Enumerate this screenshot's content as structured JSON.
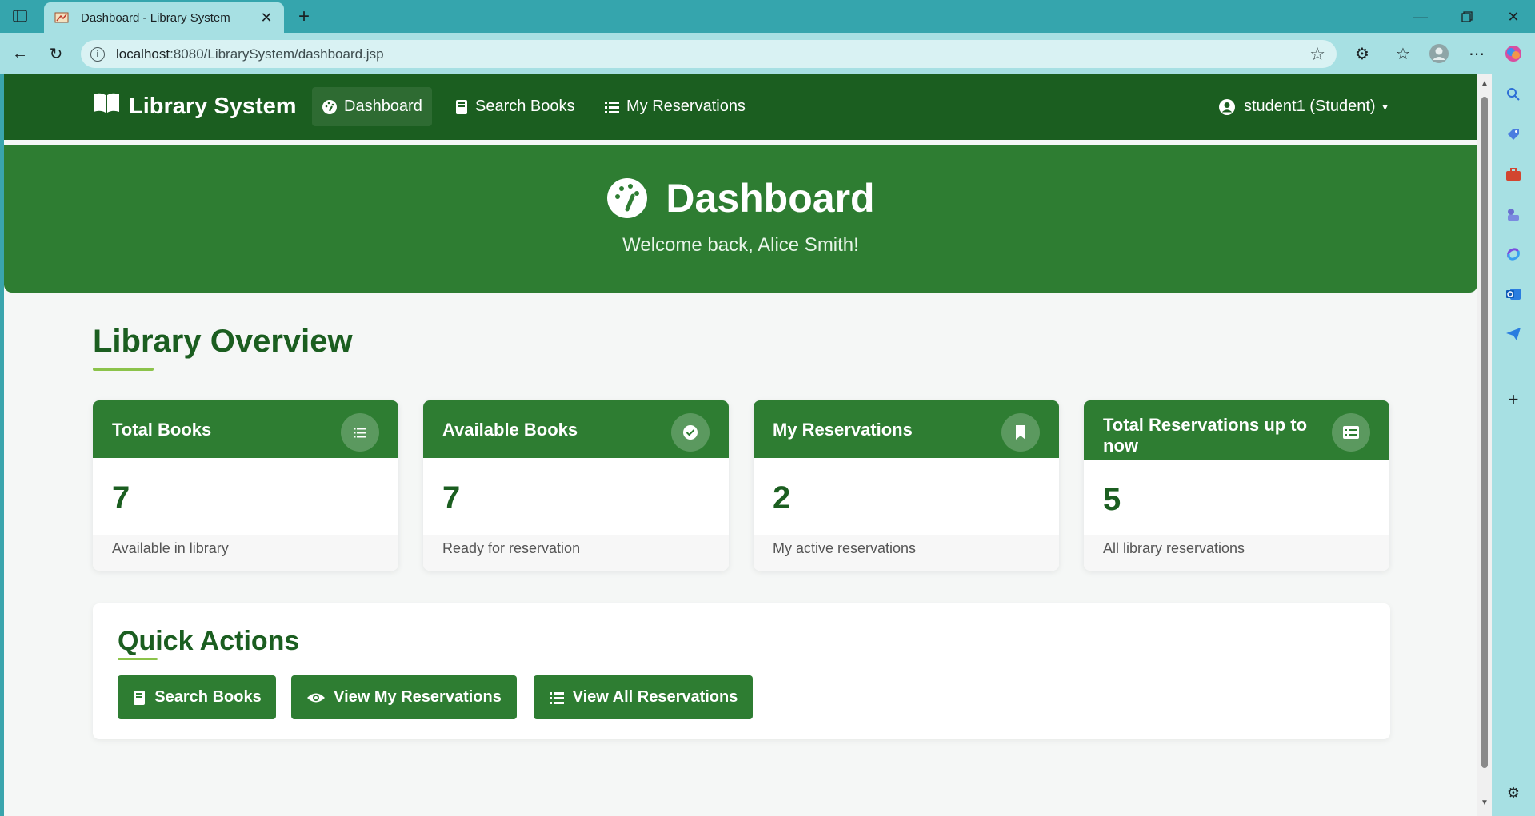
{
  "browser": {
    "tab_title": "Dashboard - Library System",
    "url_host": "localhost",
    "url_path": ":8080/LibrarySystem/dashboard.jsp"
  },
  "navbar": {
    "brand": "Library System",
    "items": [
      {
        "label": "Dashboard",
        "icon": "dashboard-icon",
        "active": true
      },
      {
        "label": "Search Books",
        "icon": "book-icon",
        "active": false
      },
      {
        "label": "My Reservations",
        "icon": "list-icon",
        "active": false
      }
    ],
    "user": "student1 (Student)"
  },
  "hero": {
    "title": "Dashboard",
    "subtitle": "Welcome back, Alice Smith!"
  },
  "overview": {
    "title": "Library Overview",
    "cards": [
      {
        "title": "Total Books",
        "value": "7",
        "footer": "Available in library",
        "icon": "list-icon"
      },
      {
        "title": "Available Books",
        "value": "7",
        "footer": "Ready for reservation",
        "icon": "check-circle-icon"
      },
      {
        "title": "My Reservations",
        "value": "2",
        "footer": "My active reservations",
        "icon": "bookmark-icon"
      },
      {
        "title": "Total Reservations up to now",
        "value": "5",
        "footer": "All library reservations",
        "icon": "list-alt-icon"
      }
    ]
  },
  "quick_actions": {
    "title": "Quick Actions",
    "buttons": [
      {
        "label": "Search Books",
        "icon": "book-icon"
      },
      {
        "label": "View My Reservations",
        "icon": "eye-icon"
      },
      {
        "label": "View All Reservations",
        "icon": "list-icon"
      }
    ]
  },
  "colors": {
    "navbar": "#1b5e20",
    "primary": "#2e7d32",
    "accent": "#8bc34a",
    "browser_frame": "#35a5ad"
  }
}
